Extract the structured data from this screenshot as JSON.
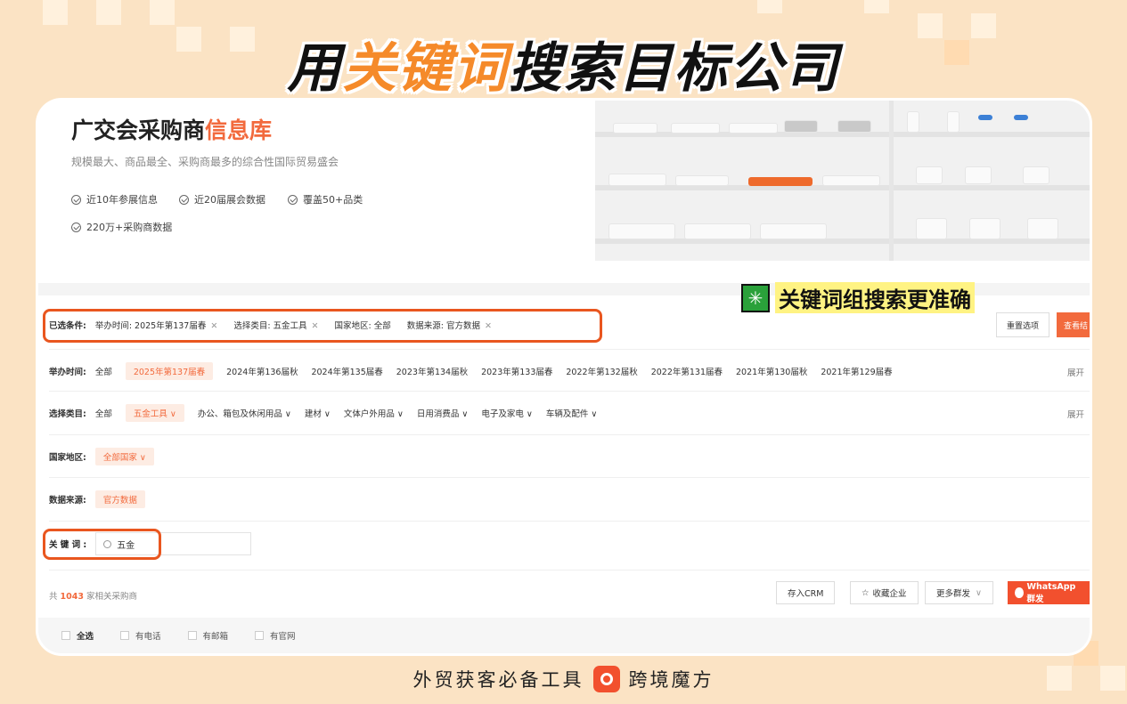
{
  "headline": {
    "part1": "用",
    "highlight": "关键词",
    "part2": "搜索目标公司"
  },
  "hero": {
    "title_main": "广交会采购商",
    "title_accent": "信息库",
    "subtitle": "规模最大、商品最全、采购商最多的综合性国际贸易盛会",
    "features": [
      "近10年参展信息",
      "近20届展会数据",
      "覆盖50+品类",
      "220万+采购商数据"
    ]
  },
  "banner": {
    "icon": "✳",
    "text": "关键词组搜索更准确"
  },
  "conditions": {
    "label": "已选条件:",
    "chips": [
      "举办时间: 2025年第137届春",
      "选择类目: 五金工具",
      "国家地区: 全部",
      "数据来源: 官方数据"
    ],
    "reset": "重置选项",
    "view": "查看结"
  },
  "filters": {
    "time": {
      "label": "举办时间:",
      "options": [
        "全部",
        "2025年第137届春",
        "2024年第136届秋",
        "2024年第135届春",
        "2023年第134届秋",
        "2023年第133届春",
        "2022年第132届秋",
        "2022年第131届春",
        "2021年第130届秋",
        "2021年第129届春"
      ],
      "expand": "展开"
    },
    "category": {
      "label": "选择类目:",
      "options": [
        "全部",
        "五金工具",
        "办公、箱包及休闲用品",
        "建材",
        "文体户外用品",
        "日用消费品",
        "电子及家电",
        "车辆及配件"
      ],
      "expand": "展开"
    },
    "region": {
      "label": "国家地区:",
      "option": "全部国家"
    },
    "source": {
      "label": "数据来源:",
      "option": "官方数据"
    },
    "keyword": {
      "label": "关 键 词 :",
      "value": "五金"
    }
  },
  "result": {
    "prefix": "共 ",
    "count": "1043",
    "suffix": " 家相关采购商"
  },
  "actions": [
    "存入CRM",
    "收藏企业",
    "更多群发",
    "WhatsApp群发"
  ],
  "checkboxes": [
    "全选",
    "有电话",
    "有邮箱",
    "有官网"
  ],
  "footer": {
    "left": "外贸获客必备工具",
    "brand": "跨境魔方"
  }
}
